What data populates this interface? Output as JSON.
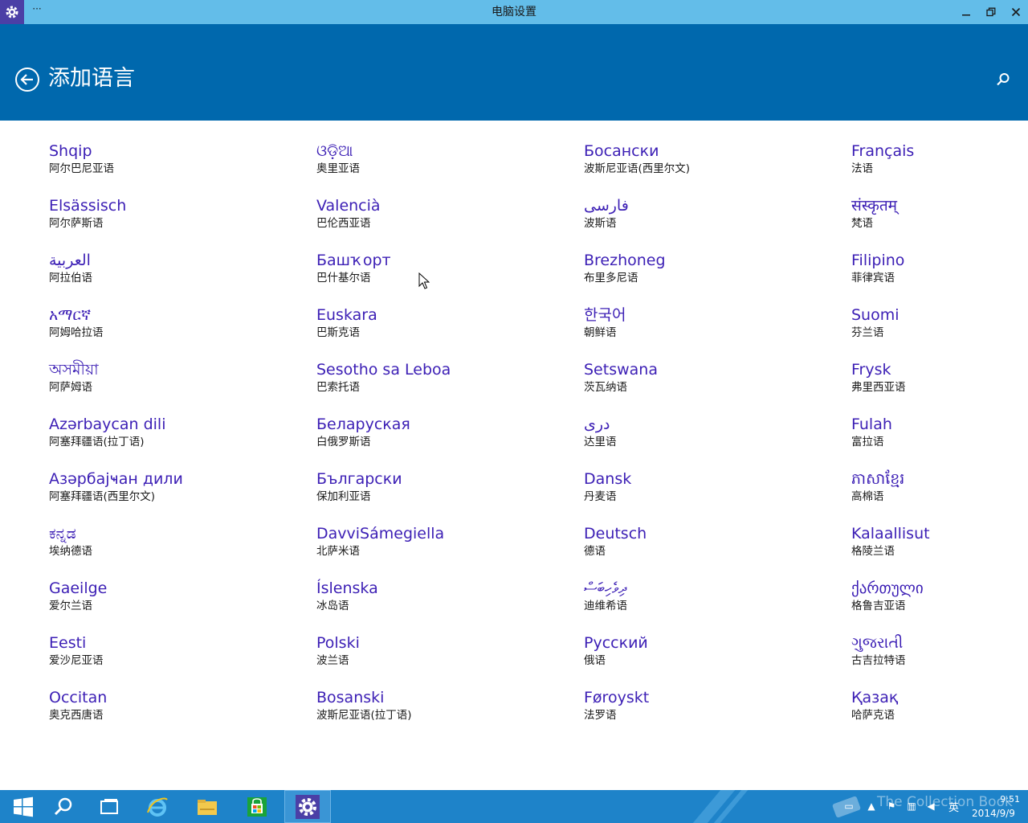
{
  "window": {
    "title": "电脑设置",
    "menu_glyph": "···"
  },
  "header": {
    "title": "添加语言"
  },
  "columns": [
    [
      {
        "native": "Shqip",
        "cn": "阿尔巴尼亚语"
      },
      {
        "native": "Elsässisch",
        "cn": "阿尔萨斯语"
      },
      {
        "native": "العربية",
        "cn": "阿拉伯语"
      },
      {
        "native": "አማርኛ",
        "cn": "阿姆哈拉语"
      },
      {
        "native": "অসমীয়া",
        "cn": "阿萨姆语"
      },
      {
        "native": "Azərbaycan dili",
        "cn": "阿塞拜疆语(拉丁语)"
      },
      {
        "native": "Азәрбајҹан дили",
        "cn": "阿塞拜疆语(西里尔文)"
      },
      {
        "native": "ಕನ್ನಡ",
        "cn": "埃纳德语"
      },
      {
        "native": "Gaeilge",
        "cn": "爱尔兰语"
      },
      {
        "native": "Eesti",
        "cn": "爱沙尼亚语"
      },
      {
        "native": "Occitan",
        "cn": "奥克西唐语"
      }
    ],
    [
      {
        "native": "ଓଡ଼ିଆ",
        "cn": "奥里亚语"
      },
      {
        "native": "Valencià",
        "cn": "巴伦西亚语"
      },
      {
        "native": "Башҡорт",
        "cn": "巴什基尔语"
      },
      {
        "native": "Euskara",
        "cn": "巴斯克语"
      },
      {
        "native": "Sesotho sa Leboa",
        "cn": "巴索托语"
      },
      {
        "native": "Беларуская",
        "cn": "白俄罗斯语"
      },
      {
        "native": "Български",
        "cn": "保加利亚语"
      },
      {
        "native": "DavviSámegiella",
        "cn": "北萨米语"
      },
      {
        "native": "Íslenska",
        "cn": "冰岛语"
      },
      {
        "native": "Polski",
        "cn": "波兰语"
      },
      {
        "native": "Bosanski",
        "cn": "波斯尼亚语(拉丁语)"
      }
    ],
    [
      {
        "native": "Босански",
        "cn": "波斯尼亚语(西里尔文)"
      },
      {
        "native": "فارسى",
        "cn": "波斯语"
      },
      {
        "native": "Brezhoneg",
        "cn": "布里多尼语"
      },
      {
        "native": "한국어",
        "cn": "朝鲜语"
      },
      {
        "native": "Setswana",
        "cn": "茨瓦纳语"
      },
      {
        "native": "درى",
        "cn": "达里语"
      },
      {
        "native": "Dansk",
        "cn": "丹麦语"
      },
      {
        "native": "Deutsch",
        "cn": "德语"
      },
      {
        "native": "ދިވެހިބަސް",
        "cn": "迪维希语"
      },
      {
        "native": "Русский",
        "cn": "俄语"
      },
      {
        "native": "Føroyskt",
        "cn": "法罗语"
      }
    ],
    [
      {
        "native": "Français",
        "cn": "法语"
      },
      {
        "native": "संस्कृतम्",
        "cn": "梵语"
      },
      {
        "native": "Filipino",
        "cn": "菲律宾语"
      },
      {
        "native": "Suomi",
        "cn": "芬兰语"
      },
      {
        "native": "Frysk",
        "cn": "弗里西亚语"
      },
      {
        "native": "Fulah",
        "cn": "富拉语"
      },
      {
        "native": "ភាសាខ្មែរ",
        "cn": "高棉语"
      },
      {
        "native": "Kalaallisut",
        "cn": "格陵兰语"
      },
      {
        "native": "ქართული",
        "cn": "格鲁吉亚语"
      },
      {
        "native": "ગુજરાતી",
        "cn": "古吉拉特语"
      },
      {
        "native": "Қазақ",
        "cn": "哈萨克语"
      }
    ]
  ],
  "taskbar": {
    "watermark": "The Collection Book",
    "ime": "英",
    "time": "9:51",
    "date": "2014/9/9"
  },
  "colors": {
    "titlebar": "#63bde9",
    "header": "#0068ad",
    "link": "#3c1fb5",
    "taskbar": "#1e83c9"
  }
}
